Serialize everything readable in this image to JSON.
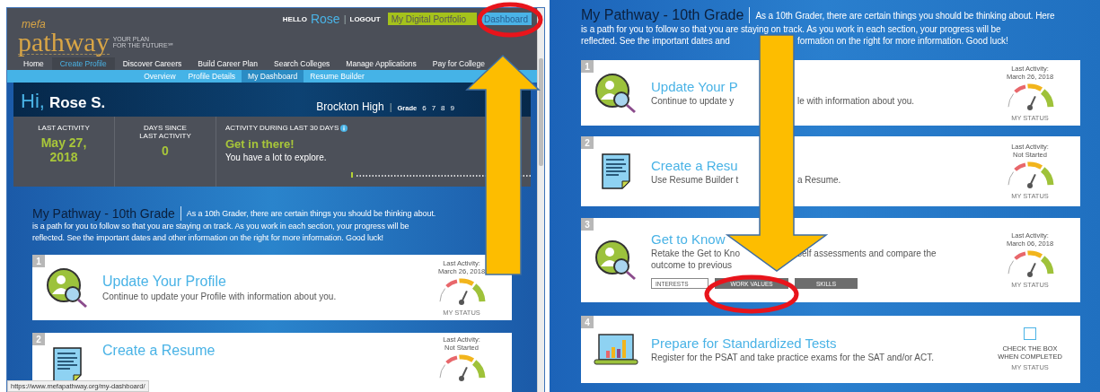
{
  "left_window": {
    "logo": {
      "brand": "mefa",
      "name": "pathway",
      "tagline": [
        "YOUR PLAN",
        "FOR THE FUTURE℠"
      ]
    },
    "greeting": {
      "hello": "HELLO",
      "user": "Rose",
      "separator": "|",
      "logout": "LOGOUT"
    },
    "top_buttons": [
      {
        "label": "My Digital Portfolio",
        "kind": "portfolio"
      },
      {
        "label": "Dashboard",
        "kind": "dashboard"
      }
    ],
    "nav": [
      {
        "label": "Home",
        "selected": false
      },
      {
        "label": "Create Profile",
        "selected": true
      },
      {
        "label": "Discover Careers",
        "selected": false
      },
      {
        "label": "Build Career Plan",
        "selected": false
      },
      {
        "label": "Search Colleges",
        "selected": false
      },
      {
        "label": "Manage Applications",
        "selected": false
      },
      {
        "label": "Pay for College",
        "selected": false
      }
    ],
    "subnav": [
      {
        "label": "Overview",
        "selected": false
      },
      {
        "label": "Profile Details",
        "selected": false
      },
      {
        "label": "My Dashboard",
        "selected": true
      },
      {
        "label": "Resume Builder",
        "selected": false
      }
    ],
    "profile": {
      "hi": "Hi,",
      "name": "Rose S.",
      "school": "Brockton High",
      "separator": "|",
      "grade_label": "Grade",
      "grades": [
        "6",
        "7",
        "8",
        "9"
      ]
    },
    "stats": [
      {
        "label": "LAST ACTIVITY",
        "value": "May 27, 2018"
      },
      {
        "label": "DAYS SINCE LAST ACTIVITY",
        "value": "0"
      }
    ],
    "activity": {
      "label": "ACTIVITY DURING LAST 30 DAYS",
      "headline": "Get in there!",
      "message": "You have a lot to explore."
    },
    "pathway": {
      "title": "My Pathway - 10th Grade",
      "lines": [
        "As a 10th Grader, there are certain things you should be thinking about.",
        "is a path for you to follow so that you are staying on track. As you work in each section, your progress will be",
        "reflected. See the important dates and other information on the right for more information. Good luck!"
      ]
    },
    "steps": [
      {
        "number": "1",
        "kind": "profile",
        "title": "Update Your Profile",
        "description": "Continue to update your Profile with information about you.",
        "activity_label": "Last Activity:",
        "activity_value": "March 26, 2018",
        "status_label": "MY STATUS"
      },
      {
        "number": "2",
        "kind": "resume",
        "title": "Create a Resume",
        "activity_label": "Last Activity:",
        "activity_value": "Not Started"
      }
    ],
    "status_url": "https://www.mefapathway.org/my-dashboard/"
  },
  "right_window": {
    "pathway": {
      "title": "My Pathway - 10th Grade",
      "lines": [
        "As a 10th Grader, there are certain things you should be thinking about. Here",
        "is a path for you to follow so that you are staying on track. As you work in each section, your progress will be"
      ],
      "cut_line": [
        "reflected. See the important dates and",
        "formation on the right for more information. Good luck!"
      ]
    },
    "steps": [
      {
        "number": "1",
        "kind": "profile",
        "title": "Update Your P",
        "description_lines": [
          [
            "Continue to update y",
            "le with information about you."
          ]
        ],
        "activity_label": "Last Activity:",
        "activity_value": "March 26, 2018",
        "status_label": "MY STATUS"
      },
      {
        "number": "2",
        "kind": "resume",
        "title": "Create a Resu",
        "description_lines": [
          [
            "Use Resume Builder t",
            "a Resume."
          ]
        ],
        "activity_label": "Last Activity:",
        "activity_value": "Not Started",
        "status_label": "MY STATUS"
      },
      {
        "number": "3",
        "kind": "assessment",
        "title": "Get to Know",
        "description_lines": [
          [
            "Retake the Get to Kno",
            "self assessments and compare the"
          ],
          [
            "outcome to previous"
          ]
        ],
        "tabs": [
          {
            "label": "INTERESTS",
            "selected": true
          },
          {
            "label": "WORK VALUES",
            "selected": false
          },
          {
            "label": "SKILLS",
            "selected": false
          }
        ],
        "activity_label": "Last Activity:",
        "activity_value": "March 06, 2018",
        "status_label": "MY STATUS"
      },
      {
        "number": "4",
        "kind": "test",
        "title": "Prepare for Standardized Tests",
        "description_lines": [
          [
            "Register for the PSAT and take practice exams for the SAT and/or ACT."
          ]
        ],
        "checked": false,
        "check_label": "CHECK THE BOX WHEN COMPLETED",
        "status_label": "MY STATUS"
      }
    ]
  }
}
